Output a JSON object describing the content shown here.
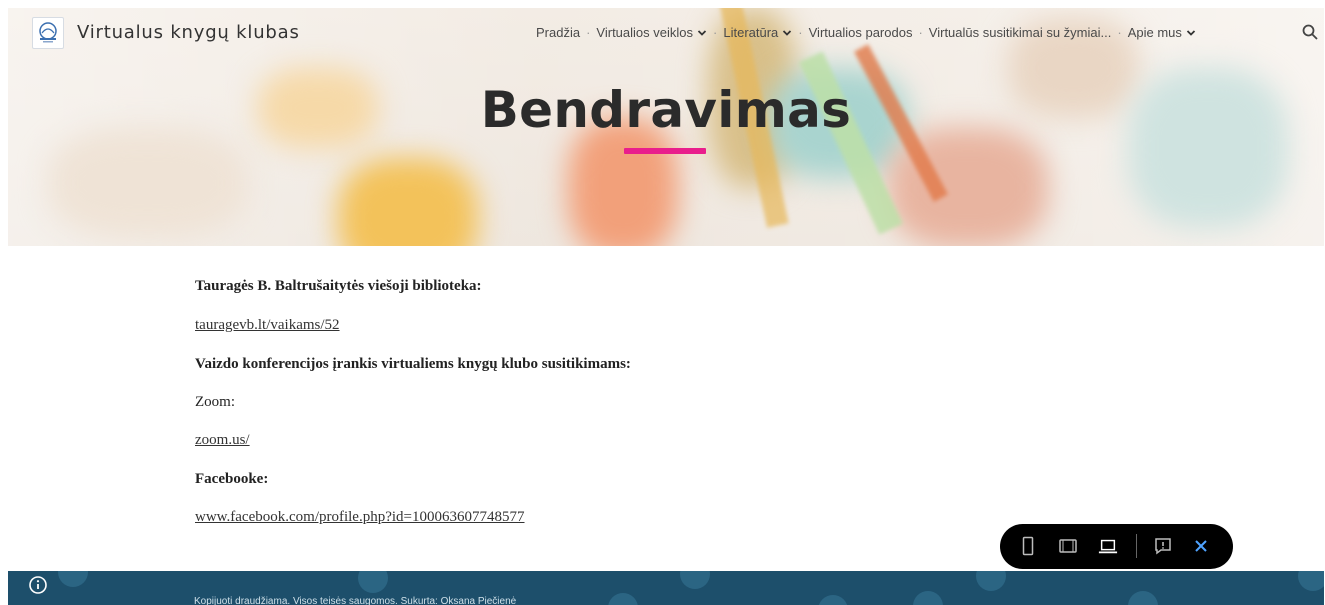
{
  "header": {
    "site_title": "Virtualus knygų klubas",
    "nav": [
      {
        "label": "Pradžia",
        "has_dropdown": false
      },
      {
        "label": "Virtualios veiklos",
        "has_dropdown": true
      },
      {
        "label": "Literatūra",
        "has_dropdown": true
      },
      {
        "label": "Virtualios parodos",
        "has_dropdown": false
      },
      {
        "label": "Virtualūs susitikimai su žymiai...",
        "has_dropdown": false
      },
      {
        "label": "Apie mus",
        "has_dropdown": true
      }
    ],
    "search_icon": "search-icon"
  },
  "hero": {
    "title": "Bendravimas",
    "underline_color": "#e91e8c"
  },
  "content": {
    "library_heading": "Tauragės B. Baltrušaitytės viešoji biblioteka:",
    "library_link": "tauragevb.lt/vaikams/52",
    "video_heading": "Vaizdo konferencijos įrankis virtualiems knygų klubo susitikimams:",
    "zoom_label": "Zoom:",
    "zoom_link": "zoom.us/",
    "facebook_heading": "Facebooke:",
    "facebook_link": "www.facebook.com/profile.php?id=100063607748577"
  },
  "footer": {
    "text": "Kopijuoti draudžiama. Visos teisės saugomos. Sukurta: Oksana Piečienė",
    "background_color": "#1d4f6b"
  },
  "preview_toolbar": {
    "icons": [
      "phone-view-icon",
      "tablet-view-icon",
      "laptop-view-icon",
      "feedback-icon",
      "close-icon"
    ],
    "active": "laptop-view-icon",
    "close_color": "#4fa3ff"
  }
}
